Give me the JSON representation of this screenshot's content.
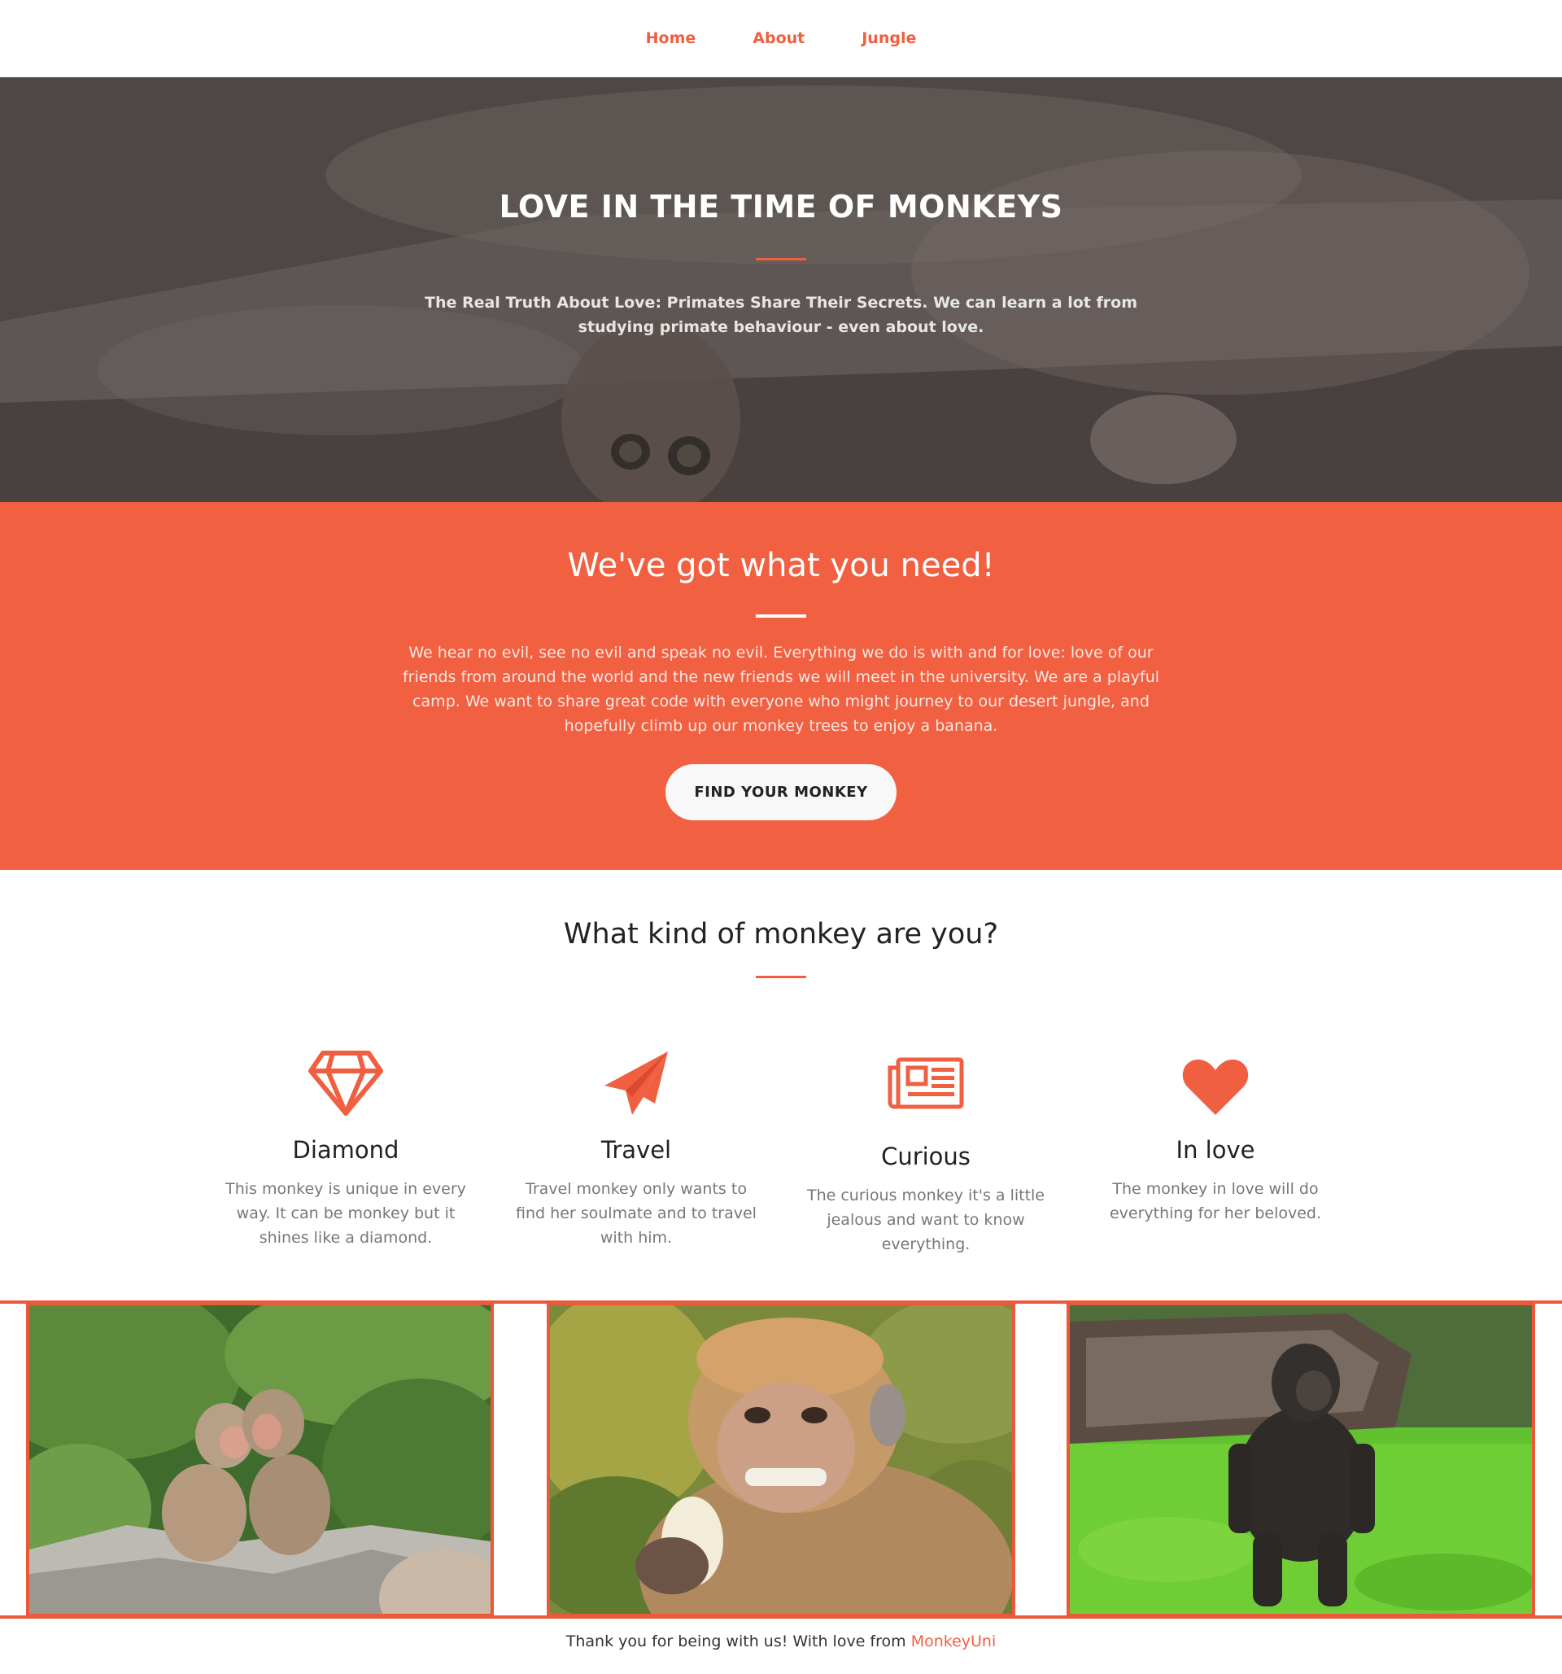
{
  "nav": {
    "items": [
      {
        "label": "Home"
      },
      {
        "label": "About"
      },
      {
        "label": "Jungle"
      }
    ]
  },
  "hero": {
    "title": "LOVE IN THE TIME OF MONKEYS",
    "subtitle": "The Real Truth About Love: Primates Share Their Secrets. We can learn a lot from studying primate behaviour - even about love."
  },
  "need": {
    "title": "We've got what you need!",
    "text": "We hear no evil, see no evil and speak no evil. Everything we do is with and for love: love of our friends from around the world and the new friends we will meet in the university. We are a playful camp. We want to share great code with everyone who might journey to our desert jungle, and hopefully climb up our monkey trees to enjoy a banana.",
    "button_label": "FIND YOUR MONKEY"
  },
  "kinds": {
    "title": "What kind of monkey are you?",
    "items": [
      {
        "icon": "diamond-icon",
        "name": "Diamond",
        "description": "This monkey is unique in every way. It can be monkey but it shines like a diamond."
      },
      {
        "icon": "paper-plane-icon",
        "name": "Travel",
        "description": "Travel monkey only wants to find her soulmate and to travel with him."
      },
      {
        "icon": "newspaper-icon",
        "name": "Curious",
        "description": "The curious monkey it's a little jealous and want to know everything."
      },
      {
        "icon": "heart-icon",
        "name": "In love",
        "description": "The monkey in love will do everything for her beloved."
      }
    ]
  },
  "gallery": {
    "photos": [
      {
        "subject": "two-baby-macaques-photo"
      },
      {
        "subject": "macaque-eating-photo"
      },
      {
        "subject": "young-gorilla-photo"
      }
    ]
  },
  "footer": {
    "text": "Thank you for being with us! With love from ",
    "brand": "MonkeyUni"
  },
  "colors": {
    "accent": "#f05f40",
    "orange_section": "#f06041",
    "text_dark": "#222222",
    "text_muted": "#777777"
  }
}
